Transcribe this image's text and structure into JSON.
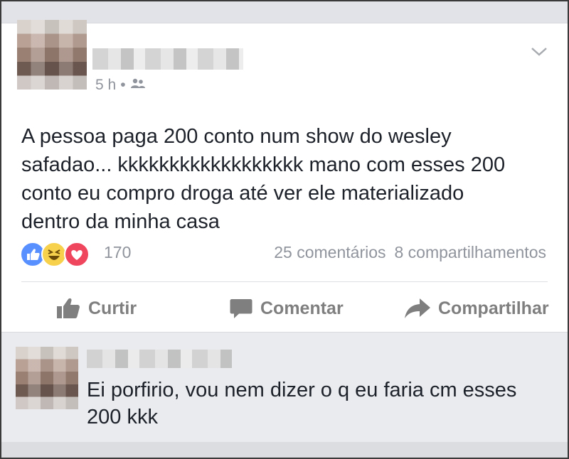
{
  "post": {
    "timestamp": "5 h",
    "separator": "•",
    "audience_icon": "friends-icon",
    "text": "A pessoa paga 200 conto num show do wesley\nsafadao... kkkkkkkkkkkkkkkkkk mano com esses 200\nconto eu compro droga até ver ele materializado\ndentro da minha casa",
    "reaction_count": "170",
    "comments_count": "25 comentários",
    "shares_count": "8 compartilhamentos"
  },
  "actions": {
    "like": "Curtir",
    "comment": "Comentar",
    "share": "Compartilhar"
  },
  "comment": {
    "text": "Ei porfirio, vou nem dizer o q eu faria cm esses 200 kkk"
  },
  "colors": {
    "like_blue": "#5890ff",
    "haha_yellow": "#f7d14b",
    "love_red": "#f0465d",
    "muted_text": "#90949c",
    "action_gray": "#7f7f7f"
  }
}
